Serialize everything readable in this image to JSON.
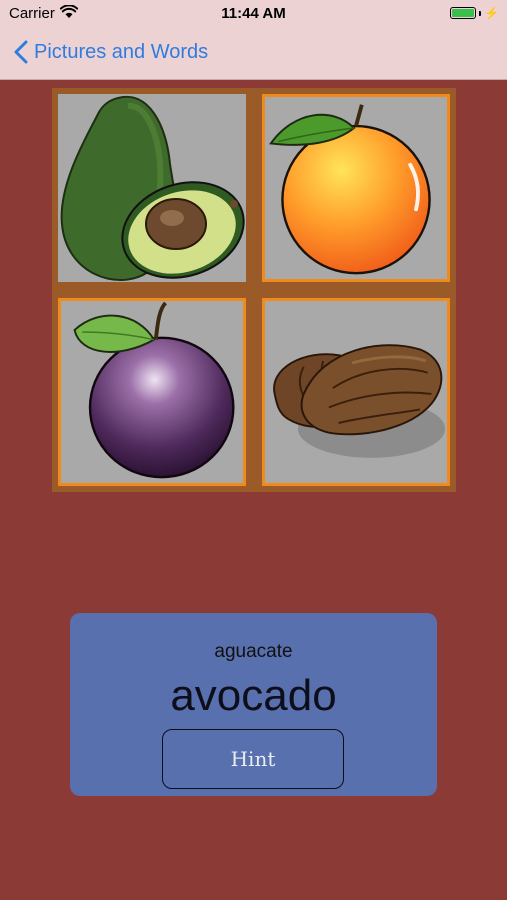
{
  "status_bar": {
    "carrier": "Carrier",
    "time": "11:44 AM",
    "battery_level": 1.0
  },
  "nav": {
    "back_label": "Pictures and Words"
  },
  "tiles": [
    {
      "name": "avocado",
      "selected": false
    },
    {
      "name": "orange",
      "selected": true
    },
    {
      "name": "plum",
      "selected": true
    },
    {
      "name": "dates",
      "selected": true
    }
  ],
  "card": {
    "native_word": "aguacate",
    "english_word": "avocado",
    "hint_label": "Hint"
  },
  "colors": {
    "background": "#8b3a35",
    "nav_bar": "#edd2d4",
    "accent": "#2f7ce0",
    "tile_selected_border": "#f08a1c",
    "card": "#5870ae"
  }
}
